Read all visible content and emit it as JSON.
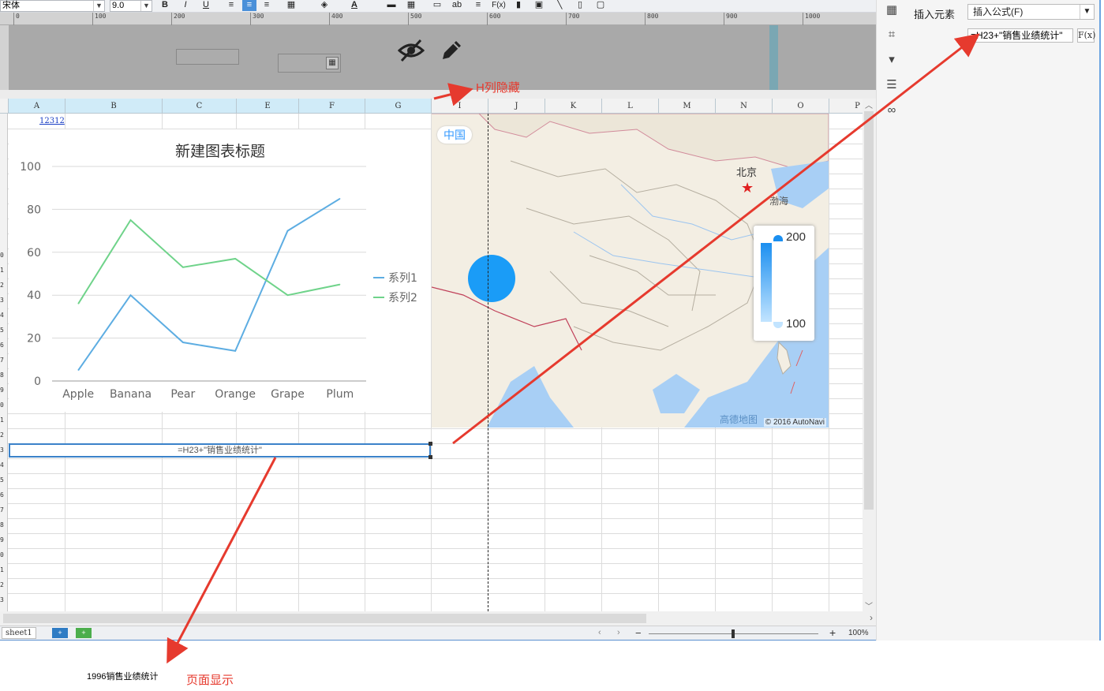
{
  "toolbar": {
    "font_name": "宋体",
    "font_size": "9.0",
    "bold": "B",
    "italic": "I",
    "underline": "U",
    "fx": "F(x)",
    "ab": "ab"
  },
  "ruler": {
    "ticks": [
      "0",
      "100",
      "200",
      "300",
      "400",
      "500",
      "600",
      "700",
      "800",
      "900",
      "1000"
    ]
  },
  "columns": [
    "A",
    "B",
    "C",
    "E",
    "F",
    "G",
    "I",
    "J",
    "K",
    "L",
    "M",
    "N",
    "O",
    "P"
  ],
  "row_numbers": [
    "0",
    "1",
    "2",
    "3",
    "4",
    "5",
    "6",
    "7",
    "8",
    "9",
    "0",
    "1",
    "2",
    "3",
    "4",
    "5",
    "6",
    "7",
    "8",
    "9",
    "0",
    "1",
    "2",
    "3"
  ],
  "cell_link": "12312",
  "chart_data": {
    "type": "line",
    "title": "新建图表标题",
    "categories": [
      "Apple",
      "Banana",
      "Pear",
      "Orange",
      "Grape",
      "Plum"
    ],
    "series": [
      {
        "name": "系列1",
        "color": "#5dade2",
        "values": [
          5,
          40,
          18,
          14,
          70,
          85
        ]
      },
      {
        "name": "系列2",
        "color": "#6fd38a",
        "values": [
          36,
          75,
          53,
          57,
          40,
          45
        ]
      }
    ],
    "ylim": [
      0,
      100
    ],
    "yticks": [
      "0",
      "20",
      "40",
      "60",
      "80",
      "100"
    ],
    "grid": true,
    "legend": "right"
  },
  "map": {
    "badge": "中国",
    "city": "北京",
    "sea": "渤海",
    "visual_max": "200",
    "visual_min": "100",
    "logo": "高德地图",
    "copyright": "© 2016 AutoNavi",
    "bubble_color": "#1a9cf7"
  },
  "selected_cell_formula": "=H23+\"销售业绩统计\"",
  "sheet_tab": "sheet1",
  "zoom": "100%",
  "zoom_minus": "−",
  "zoom_plus": "+",
  "side_panel": {
    "label": "插入元素",
    "select_value": "插入公式(F)",
    "formula_value": "=H23+\"销售业绩统计\"",
    "fx_button": "F(x)"
  },
  "annotations": {
    "hidden_column": "H列隐藏",
    "page_display": "页面显示",
    "page_result": "1996销售业绩统计"
  },
  "colors": {
    "accent": "#3b82c9",
    "arrow": "#e63a2e"
  }
}
